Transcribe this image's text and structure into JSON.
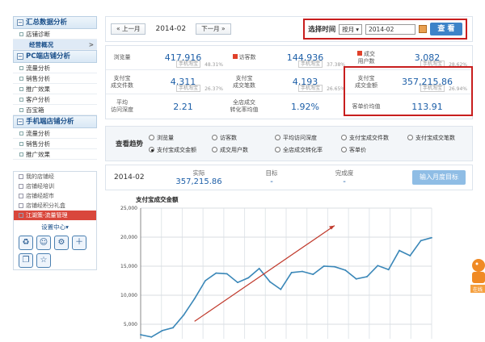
{
  "sidebar": {
    "sections": [
      {
        "title": "汇总数据分析",
        "items": [
          {
            "label": "店铺诊断"
          },
          {
            "label": "经营概况",
            "active": true,
            "arrow": ">"
          }
        ]
      },
      {
        "title": "PC端店铺分析",
        "items": [
          {
            "label": "流量分析"
          },
          {
            "label": "销售分析"
          },
          {
            "label": "推广效果"
          },
          {
            "label": "客户分析"
          },
          {
            "label": "百宝箱"
          }
        ]
      },
      {
        "title": "手机端店铺分析",
        "items": [
          {
            "label": "流量分析"
          },
          {
            "label": "销售分析"
          },
          {
            "label": "推广效果"
          }
        ]
      }
    ],
    "tools": [
      {
        "label": "我的店铺经"
      },
      {
        "label": "店铺经培训"
      },
      {
        "label": "店铺经超市"
      },
      {
        "label": "店铺经积分礼盒"
      },
      {
        "label": "江湖策-流量管理",
        "highlight": true
      }
    ],
    "settings_label": "设置中心",
    "settings_chevron": "▾",
    "icon_buttons": [
      "♻",
      "☺",
      "⚙",
      "＋",
      "❐",
      "☆"
    ]
  },
  "topbar": {
    "prev_label": "« 上一月",
    "current_month": "2014-02",
    "next_label": "下一月 »",
    "time_label": "选择时间",
    "granularity": "按月",
    "granularity_arrow": "▾",
    "date_value": "2014-02",
    "query_label": "查 看"
  },
  "metrics": [
    [
      {
        "label": "浏览量",
        "value": "417,916",
        "tag": "手机淘宝",
        "pct": "48.31%"
      },
      {
        "label": "访客数",
        "value": "144,936",
        "tag": "手机淘宝",
        "pct": "37.38%",
        "icon": true
      },
      {
        "label": "成交\n用户数",
        "value": "3,082",
        "tag": "手机淘宝",
        "pct": "28.62%",
        "icon": true
      }
    ],
    [
      {
        "label": "支付宝\n成交件数",
        "value": "4,311",
        "tag": "手机淘宝",
        "pct": "26.37%"
      },
      {
        "label": "支付宝\n成交笔数",
        "value": "4,193",
        "tag": "手机淘宝",
        "pct": "26.65%"
      },
      {
        "label": "支付宝\n成交金额",
        "value": "357,215.86",
        "tag": "手机淘宝",
        "pct": "26.94%"
      }
    ],
    [
      {
        "label": "平均\n访问深度",
        "value": "2.21"
      },
      {
        "label": "全店成交\n转化率均值",
        "value": "1.92%"
      },
      {
        "label": "客单价均值",
        "value": "113.91"
      }
    ]
  ],
  "trend": {
    "title": "查看趋势",
    "options": [
      {
        "label": "浏览量",
        "checked": false
      },
      {
        "label": "访客数",
        "checked": false
      },
      {
        "label": "平均访问深度",
        "checked": false
      },
      {
        "label": "支付宝成交件数",
        "checked": false
      },
      {
        "label": "支付宝成交笔数",
        "checked": false
      },
      {
        "label": "支付宝成交金额",
        "checked": true
      },
      {
        "label": "成交用户数",
        "checked": false
      },
      {
        "label": "全店成交转化率",
        "checked": false
      },
      {
        "label": "客单价",
        "checked": false
      }
    ]
  },
  "goal": {
    "month": "2014-02",
    "actual_label": "实际",
    "actual_value": "357,215.86",
    "target_label": "目标",
    "target_value": "-",
    "completion_label": "完成度",
    "completion_value": "-",
    "button_label": "输入月度目标"
  },
  "chart_data": {
    "type": "line",
    "title": "支付宝成交金额",
    "xlabel": "",
    "ylabel": "",
    "ylim": [
      2500,
      25000
    ],
    "yticks": [
      5000,
      10000,
      15000,
      20000,
      25000
    ],
    "ytick_labels": [
      "5,000",
      "10,000",
      "15,000",
      "20,000",
      "25,000"
    ],
    "grid": true,
    "series": [
      {
        "values": [
          3200,
          2800,
          3900,
          4400,
          6600,
          9400,
          12500,
          13800,
          13700,
          12200,
          13000,
          14600,
          12300,
          11000,
          13900,
          14100,
          13600,
          15000,
          14900,
          14300,
          12800,
          13200,
          15100,
          14400,
          17700,
          16800,
          19400,
          19900
        ],
        "color": "#3a87b8"
      }
    ],
    "trend_arrow": {
      "color": "#c0392b"
    }
  },
  "mascot_caption": "在线"
}
